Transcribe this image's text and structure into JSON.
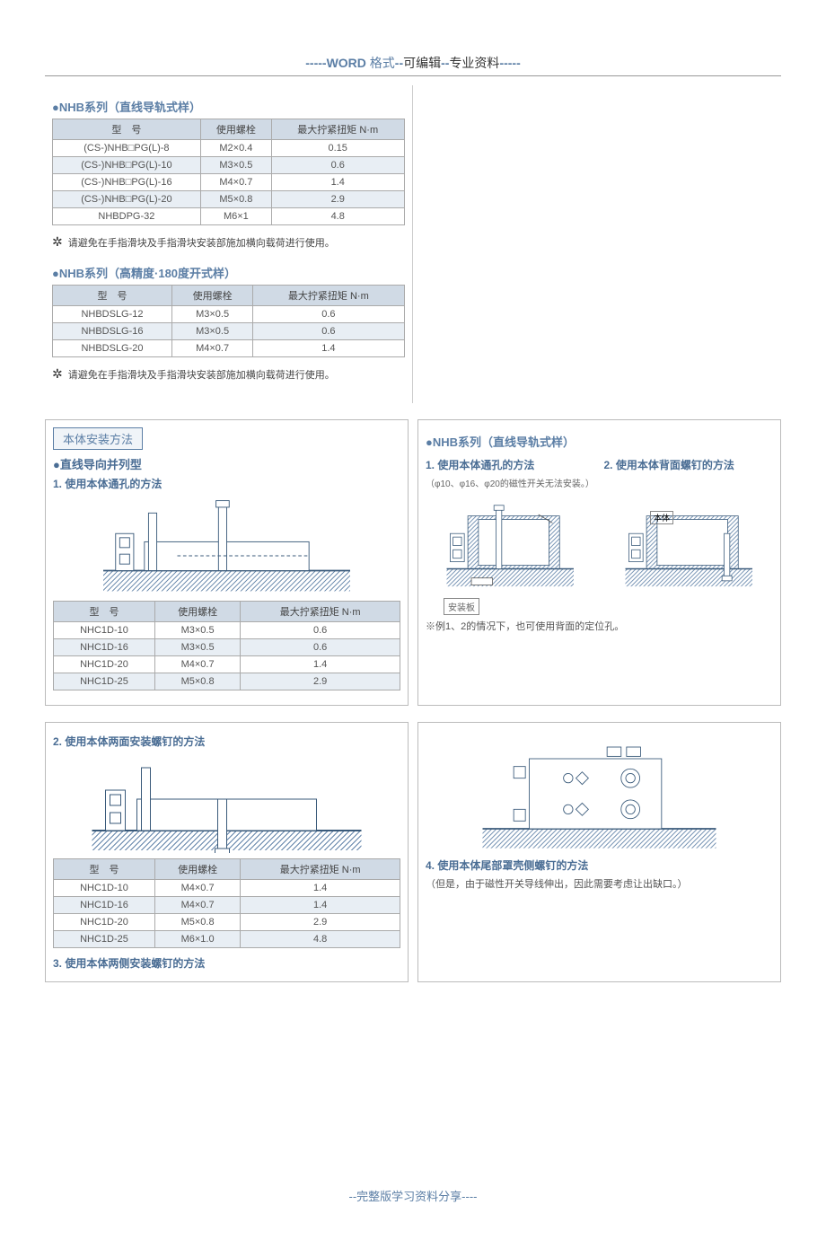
{
  "header": {
    "dash_prefix": "-----",
    "word": "WORD",
    "format": " 格式",
    "sep1": "--",
    "editable": "可编辑",
    "sep2": "--",
    "professional": "专业资料",
    "dash_suffix": "-----"
  },
  "section_nhb_linear": {
    "title": "●NHB系列（直线导轨式样）",
    "headers": [
      "型　号",
      "使用螺栓",
      "最大拧紧扭矩 N·m"
    ],
    "rows": [
      [
        "(CS-)NHB□PG(L)-8",
        "M2×0.4",
        "0.15"
      ],
      [
        "(CS-)NHB□PG(L)-10",
        "M3×0.5",
        "0.6"
      ],
      [
        "(CS-)NHB□PG(L)-16",
        "M4×0.7",
        "1.4"
      ],
      [
        "(CS-)NHB□PG(L)-20",
        "M5×0.8",
        "2.9"
      ],
      [
        "NHBDPG-32",
        "M6×1",
        "4.8"
      ]
    ],
    "note": "请避免在手指滑块及手指滑块安装部施加横向载荷进行使用。"
  },
  "section_nhb_high": {
    "title": "●NHB系列（高精度·180度开式样）",
    "headers": [
      "型　号",
      "使用螺栓",
      "最大拧紧扭矩 N·m"
    ],
    "rows": [
      [
        "NHBDSLG-12",
        "M3×0.5",
        "0.6"
      ],
      [
        "NHBDSLG-16",
        "M3×0.5",
        "0.6"
      ],
      [
        "NHBDSLG-20",
        "M4×0.7",
        "1.4"
      ]
    ],
    "note": "请避免在手指滑块及手指滑块安装部施加横向载荷进行使用。"
  },
  "install_box": "本体安装方法",
  "linear_parallel": {
    "title": "●直线导向并列型",
    "method1": "1. 使用本体通孔的方法",
    "headers": [
      "型　号",
      "使用螺栓",
      "最大拧紧扭矩 N·m"
    ],
    "rows": [
      [
        "NHC1D-10",
        "M3×0.5",
        "0.6"
      ],
      [
        "NHC1D-16",
        "M3×0.5",
        "0.6"
      ],
      [
        "NHC1D-20",
        "M4×0.7",
        "1.4"
      ],
      [
        "NHC1D-25",
        "M5×0.8",
        "2.9"
      ]
    ]
  },
  "method2": {
    "title": "2. 使用本体两面安装螺钉的方法",
    "headers": [
      "型　号",
      "使用螺栓",
      "最大拧紧扭矩 N·m"
    ],
    "rows": [
      [
        "NHC1D-10",
        "M4×0.7",
        "1.4"
      ],
      [
        "NHC1D-16",
        "M4×0.7",
        "1.4"
      ],
      [
        "NHC1D-20",
        "M5×0.8",
        "2.9"
      ],
      [
        "NHC1D-25",
        "M6×1.0",
        "4.8"
      ]
    ]
  },
  "method3": {
    "title": "3. 使用本体两侧安装螺钉的方法"
  },
  "nhb_right": {
    "title": "●NHB系列（直线导轨式样）",
    "method1": "1. 使用本体通孔的方法",
    "method2": "2. 使用本体背面螺钉的方法",
    "small_note": "（φ10、φ16、φ20的磁性开关无法安装。）",
    "body_label": "本体",
    "plate_label": "安装板",
    "example_note": "※例1、2的情况下，也可使用背面的定位孔。"
  },
  "method4": {
    "title": "4. 使用本体尾部罩壳侧螺钉的方法",
    "note": "（但是，由于磁性开关导线伸出，因此需要考虑让出缺口。）"
  },
  "footer": "--完整版学习资料分享----"
}
